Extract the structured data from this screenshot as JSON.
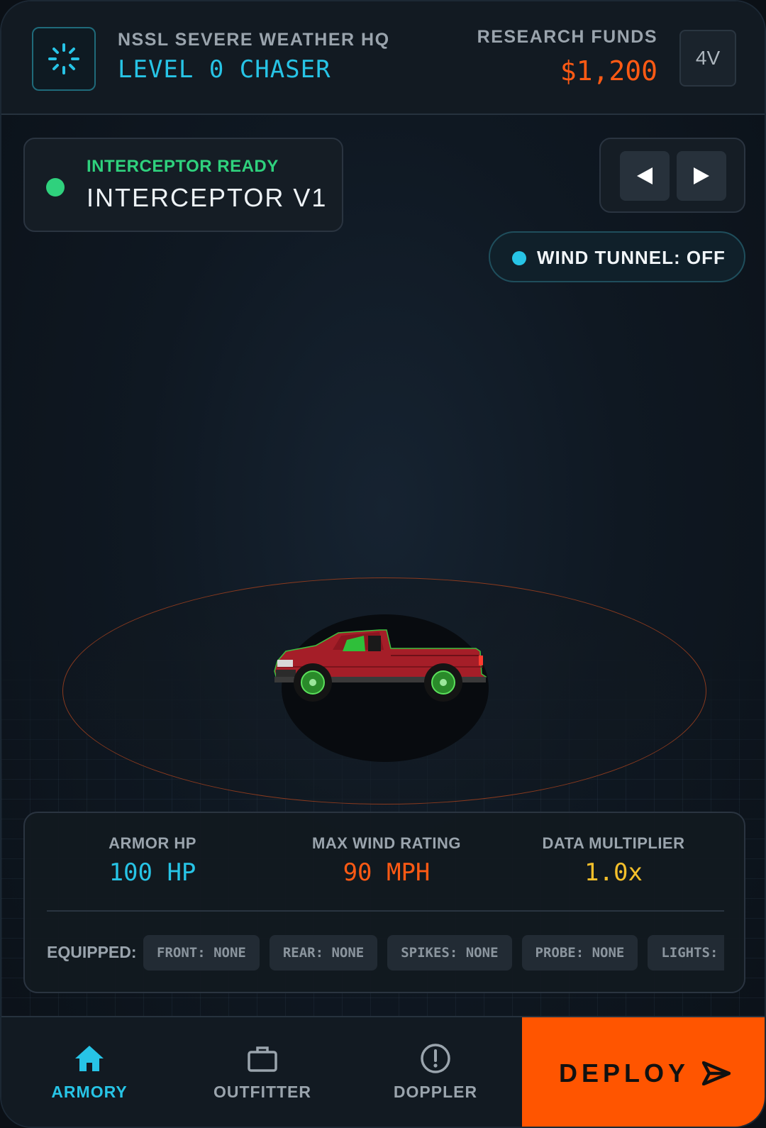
{
  "header": {
    "hq_title": "NSSL SEVERE WEATHER HQ",
    "rank": "LEVEL 0 CHASER",
    "funds_label": "RESEARCH FUNDS",
    "funds_value": "$1,200",
    "version_button": "4V"
  },
  "vehicle": {
    "status": "INTERCEPTOR READY",
    "name": "INTERCEPTOR V1",
    "status_color": "#2fd17d"
  },
  "wind_tunnel": {
    "label": "WIND TUNNEL: OFF"
  },
  "stats": {
    "armor": {
      "label": "ARMOR HP",
      "value": "100 HP",
      "color": "#27c4e6"
    },
    "wind": {
      "label": "MAX WIND RATING",
      "value": "90 MPH",
      "color": "#ff5a14"
    },
    "multiplier": {
      "label": "DATA MULTIPLIER",
      "value": "1.0x",
      "color": "#f5c02b"
    }
  },
  "equipped": {
    "label": "EQUIPPED:",
    "chips": [
      "FRONT: NONE",
      "REAR: NONE",
      "SPIKES: NONE",
      "PROBE: NONE",
      "LIGHTS: NONE"
    ]
  },
  "nav": {
    "items": [
      {
        "label": "ARMORY",
        "icon": "home-icon",
        "active": true
      },
      {
        "label": "OUTFITTER",
        "icon": "briefcase-icon",
        "active": false
      },
      {
        "label": "DOPPLER",
        "icon": "alert-circle-icon",
        "active": false
      }
    ],
    "deploy_label": "DEPLOY"
  },
  "colors": {
    "accent_cyan": "#27c4e6",
    "accent_orange": "#ff5500",
    "status_green": "#2fd17d"
  }
}
